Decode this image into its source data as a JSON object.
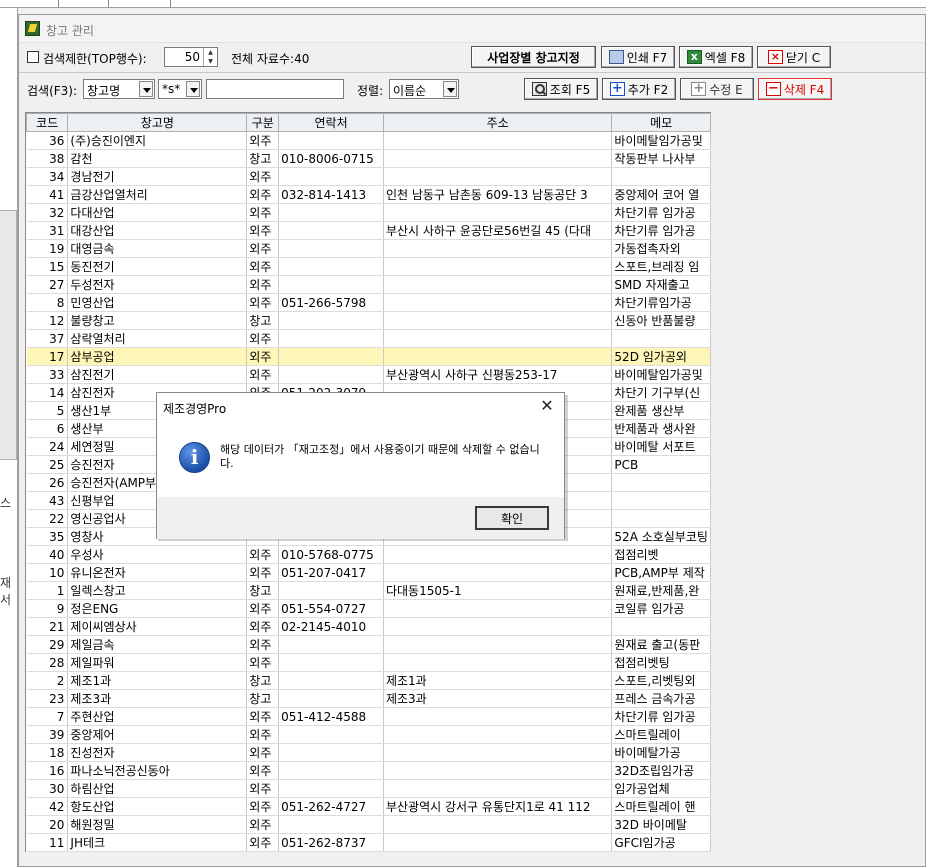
{
  "window": {
    "title": "창고 관리"
  },
  "sidebar_fragments": [
    "스",
    "재서"
  ],
  "toolbar": {
    "limit_label": "검색제한(TOP행수):",
    "limit_value": "50",
    "total_label": "전체 자료수:",
    "total_value": "40",
    "site_button": "사업장별 창고지정",
    "print_button": "인쇄 F7",
    "excel_button": "엑셀 F8",
    "close_button": "닫기 C"
  },
  "search": {
    "label": "검색(F3):",
    "field_value": "창고명",
    "match_value": "*s*",
    "text_value": "",
    "sort_label": "정렬:",
    "sort_value": "이름순",
    "query_button": "조회 F5",
    "add_button": "추가 F2",
    "edit_button": "수정 E",
    "delete_button": "삭제 F4"
  },
  "grid": {
    "columns": [
      "코드",
      "창고명",
      "구분",
      "연락처",
      "주소",
      "메모"
    ],
    "selected_index": 12,
    "rows": [
      [
        "36",
        "(주)승진이엔지",
        "외주",
        "",
        "",
        "바이메탈임가공및"
      ],
      [
        "38",
        "감천",
        "창고",
        "010-8006-0715",
        "",
        "작동판부 나사부"
      ],
      [
        "34",
        "경남전기",
        "외주",
        "",
        "",
        ""
      ],
      [
        "41",
        "금강산업열처리",
        "외주",
        "032-814-1413",
        "인천 남동구 남촌동 609-13 남동공단 3",
        "중앙제어 코어 열"
      ],
      [
        "32",
        "다대산업",
        "외주",
        "",
        "",
        "차단기류 임가공"
      ],
      [
        "31",
        "대강산업",
        "외주",
        "",
        "부산시 사하구 윤공단로56번길 45 (다대",
        "차단기류 임가공"
      ],
      [
        "19",
        "대영금속",
        "외주",
        "",
        "",
        "가동접촉자외"
      ],
      [
        "15",
        "동진전기",
        "외주",
        "",
        "",
        "스포트,브레징 임"
      ],
      [
        "27",
        "두성전자",
        "외주",
        "",
        "",
        "SMD 자재출고"
      ],
      [
        "8",
        "민영산업",
        "외주",
        "051-266-5798",
        "",
        "차단기류임가공"
      ],
      [
        "12",
        "불량창고",
        "창고",
        "",
        "",
        "신동아 반품불량"
      ],
      [
        "37",
        "삼락열처리",
        "외주",
        "",
        "",
        ""
      ],
      [
        "17",
        "삼부공업",
        "외주",
        "",
        "",
        "52D 임가공외"
      ],
      [
        "33",
        "삼진전기",
        "외주",
        "",
        "부산광역시 사하구 신평동253-17",
        "바이메탈임가공및"
      ],
      [
        "14",
        "삼진전자",
        "외주",
        "051-202-3079",
        "",
        "차단기 기구부(신"
      ],
      [
        "5",
        "생산1부",
        "",
        "",
        "",
        "완제품 생산부"
      ],
      [
        "6",
        "생산부",
        "",
        "",
        "",
        "반제품과 생사완"
      ],
      [
        "24",
        "세연정밀",
        "",
        "",
        "",
        "바이메탈 서포트"
      ],
      [
        "25",
        "승진전자",
        "",
        "",
        "",
        "PCB"
      ],
      [
        "26",
        "승진전자(AMP부",
        "",
        "",
        "",
        ""
      ],
      [
        "43",
        "신평부업",
        "",
        "",
        "",
        ""
      ],
      [
        "22",
        "영신공업사",
        "",
        "",
        "",
        ""
      ],
      [
        "35",
        "영창사",
        "",
        "",
        "",
        "52A 소호실부코팅"
      ],
      [
        "40",
        "우성사",
        "외주",
        "010-5768-0775",
        "",
        "접점리벳"
      ],
      [
        "10",
        "유니온전자",
        "외주",
        "051-207-0417",
        "",
        "PCB,AMP부 제작"
      ],
      [
        "1",
        "일렉스창고",
        "창고",
        "",
        "다대동1505-1",
        "원재료,반제품,완"
      ],
      [
        "9",
        "정은ENG",
        "외주",
        "051-554-0727",
        "",
        "코일류 임가공"
      ],
      [
        "21",
        "제이씨엠상사",
        "외주",
        "02-2145-4010",
        "",
        ""
      ],
      [
        "29",
        "제일금속",
        "외주",
        "",
        "",
        "원재료 출고(동판"
      ],
      [
        "28",
        "제일파워",
        "외주",
        "",
        "",
        "접점리벳팅"
      ],
      [
        "2",
        "제조1과",
        "창고",
        "",
        "제조1과",
        "스포트,리벳팅외"
      ],
      [
        "23",
        "제조3과",
        "창고",
        "",
        "제조3과",
        "프레스 금속가공"
      ],
      [
        "7",
        "주현산업",
        "외주",
        "051-412-4588",
        "",
        "차단기류 임가공"
      ],
      [
        "39",
        "중앙제어",
        "외주",
        "",
        "",
        "스마트릴레이"
      ],
      [
        "18",
        "진성전자",
        "외주",
        "",
        "",
        "바이메탈가공"
      ],
      [
        "16",
        "파나소닉전공신동아",
        "외주",
        "",
        "",
        "32D조립임가공"
      ],
      [
        "30",
        "하림산업",
        "외주",
        "",
        "",
        "임가공업체"
      ],
      [
        "42",
        "항도산업",
        "외주",
        "051-262-4727",
        "부산광역시 강서구 유통단지1로 41 112",
        "스마트릴레이 핸"
      ],
      [
        "20",
        "해원정밀",
        "외주",
        "",
        "",
        "32D 바이메탈"
      ],
      [
        "11",
        "JH테크",
        "외주",
        "051-262-8737",
        "",
        "GFCI임가공"
      ]
    ]
  },
  "dialog": {
    "title": "제조경영Pro",
    "message": "해당 데이터가 「재고조정」에서 사용중이기 때문에 삭제할 수 없습니다.",
    "ok_button": "확인"
  }
}
